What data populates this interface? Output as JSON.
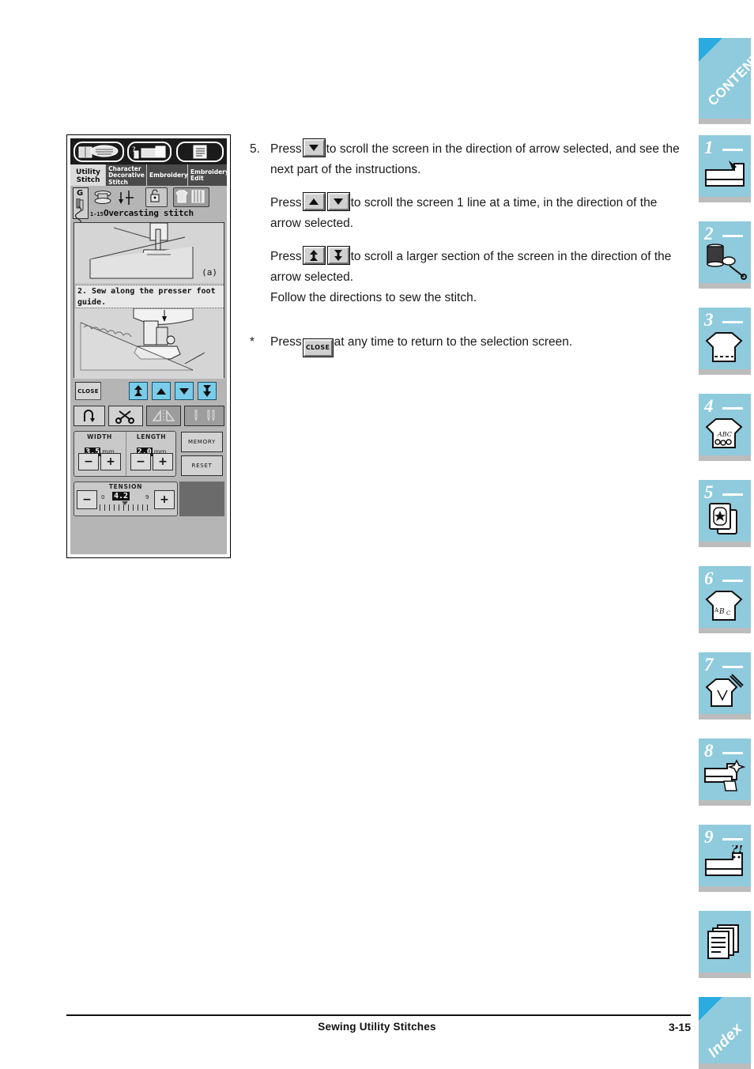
{
  "page": {
    "footer_title": "Sewing Utility Stitches",
    "page_number": "3-15"
  },
  "content": {
    "steps": [
      {
        "number": "5.",
        "segments": [
          "Press ",
          "[down-arrow-button]",
          " to scroll the screen in the direction of arrow selected, and see the next part of the instructions."
        ]
      }
    ],
    "step5_num": "5.",
    "step5_lead": "Press",
    "step5_tail": "to scroll the screen in the direction of arrow selected, and see the next part of the instructions.",
    "para2_lead": "Press",
    "para2_tail": "to scroll the screen 1 line at a time, in the direction of the arrow selected.",
    "para3_lead": "Press",
    "para3_tail": "to scroll a larger section of the screen in the direction of the arrow selected.",
    "para4": "Follow the directions to sew the stitch.",
    "note_marker": "*",
    "note_lead": "Press",
    "note_button_label": "CLOSE",
    "note_tail": "at any time to return to the selection screen."
  },
  "lcd": {
    "top_buttons": [
      {
        "name": "manual-book-icon"
      },
      {
        "name": "machine-help-icon"
      },
      {
        "name": "settings-list-icon"
      }
    ],
    "tabs": [
      {
        "label": "Utility\nStitch",
        "label_line1": "Utility",
        "label_line2": "Stitch",
        "active": true
      },
      {
        "label_line1": "Character",
        "label_line2": "Decorative",
        "label_line3": "Stitch",
        "active": false
      },
      {
        "label_line1": "Embroidery",
        "active": false
      },
      {
        "label_line1": "Embroidery",
        "label_line2": "Edit",
        "active": false
      }
    ],
    "presser_foot_letter": "G",
    "stitch_number": "1-15",
    "stitch_name": "Overcasting stitch",
    "instruction_text": "2. Sew along the presser foot guide.",
    "callout_label": "(a)",
    "close_label": "CLOSE",
    "scroll_buttons": [
      {
        "name": "scroll-page-up-button",
        "glyph": "page-up"
      },
      {
        "name": "scroll-line-up-button",
        "glyph": "line-up"
      },
      {
        "name": "scroll-line-down-button",
        "glyph": "line-down"
      },
      {
        "name": "scroll-page-down-button",
        "glyph": "page-down"
      }
    ],
    "function_buttons": [
      {
        "name": "reverse-stitch-button"
      },
      {
        "name": "thread-cutter-button"
      },
      {
        "name": "mirror-image-button"
      },
      {
        "name": "needle-mode-button"
      }
    ],
    "width": {
      "title": "WIDTH",
      "value": "3.5",
      "unit": "mm",
      "minus": "−",
      "plus": "+"
    },
    "length": {
      "title": "LENGTH",
      "value": "2.0",
      "unit": "mm",
      "minus": "−",
      "plus": "+"
    },
    "memory_label": "MEMORY",
    "reset_label": "RESET",
    "tension": {
      "title": "TENSION",
      "value": "4.2",
      "min": "0",
      "max": "9",
      "minus": "−",
      "plus": "+"
    }
  },
  "sidebar": {
    "accent_color": "#8fcadd",
    "corner_color": "#29abe2",
    "shadow_color": "#bcbcbc",
    "items": [
      {
        "name": "contents-tab",
        "label": "CONTENTS",
        "type": "diagonal",
        "icon": "contents-icon"
      },
      {
        "name": "chapter-1-tab",
        "label": "1",
        "type": "numbered",
        "icon": "sewing-machine-icon"
      },
      {
        "name": "chapter-2-tab",
        "label": "2",
        "type": "numbered",
        "icon": "thread-spool-icon"
      },
      {
        "name": "chapter-3-tab",
        "label": "3",
        "type": "numbered",
        "icon": "shirt-stitch-icon"
      },
      {
        "name": "chapter-4-tab",
        "label": "4",
        "type": "numbered",
        "icon": "shirt-abc-icon"
      },
      {
        "name": "chapter-5-tab",
        "label": "5",
        "type": "numbered",
        "icon": "embroidery-card-icon"
      },
      {
        "name": "chapter-6-tab",
        "label": "6",
        "type": "numbered",
        "icon": "shirt-letters-icon"
      },
      {
        "name": "chapter-7-tab",
        "label": "7",
        "type": "numbered",
        "icon": "shirt-needle-icon"
      },
      {
        "name": "chapter-8-tab",
        "label": "8",
        "type": "numbered",
        "icon": "machine-clean-icon"
      },
      {
        "name": "chapter-9-tab",
        "label": "9",
        "type": "numbered",
        "icon": "machine-question-icon"
      },
      {
        "name": "appendix-tab",
        "label": "",
        "type": "plain",
        "icon": "documents-icon"
      },
      {
        "name": "index-tab",
        "label": "Index",
        "type": "diagonal",
        "icon": "index-icon"
      }
    ]
  }
}
